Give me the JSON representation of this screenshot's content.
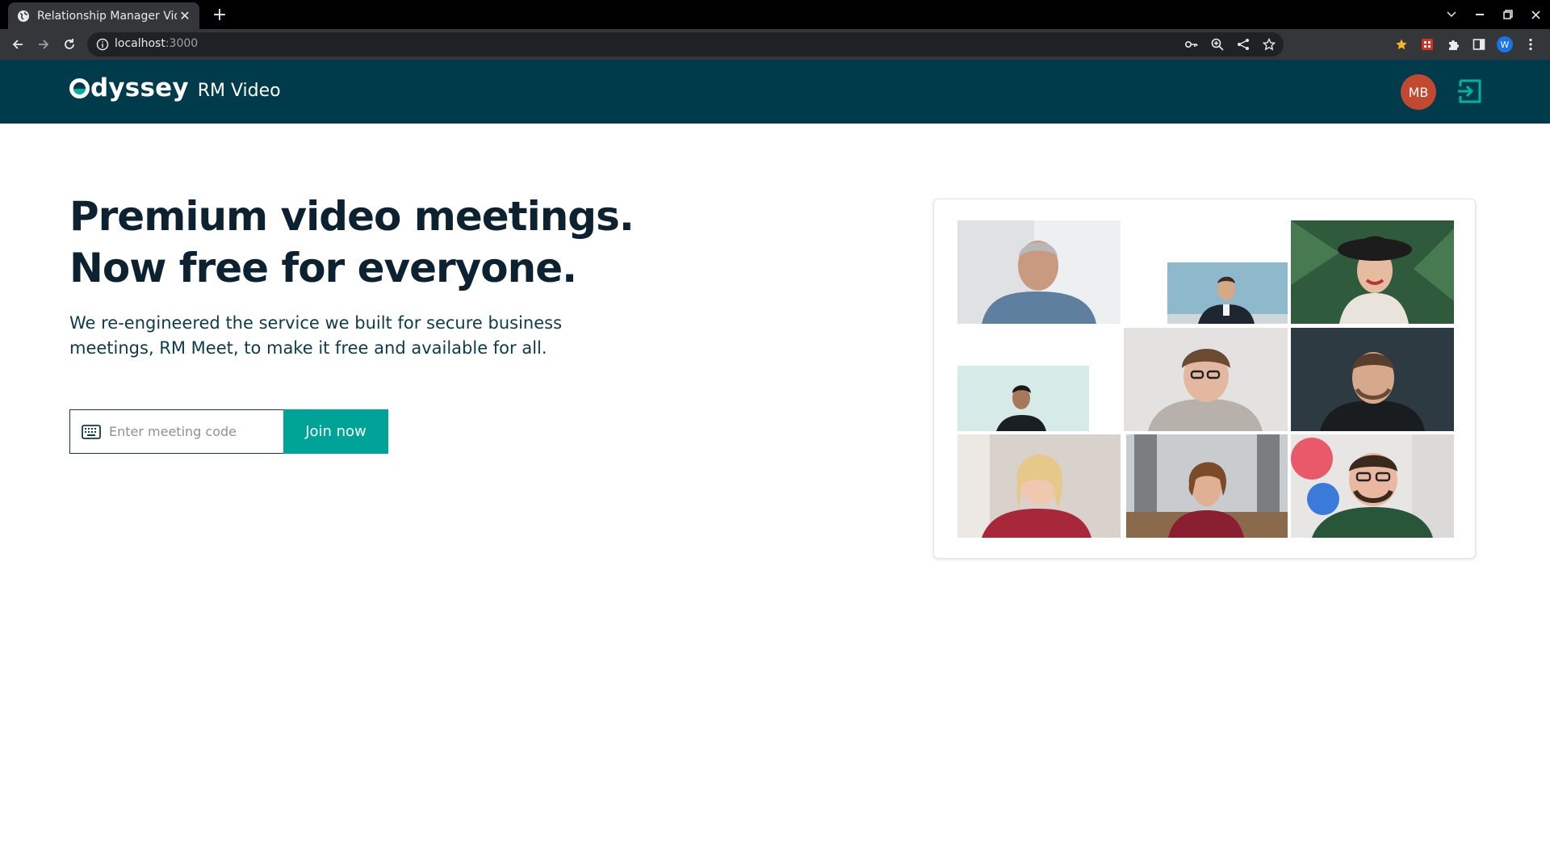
{
  "browser": {
    "tab_title": "Relationship Manager Video",
    "url_host": "localhost",
    "url_port": ":3000",
    "profile_initial": "W"
  },
  "header": {
    "brand_name": "dyssey",
    "product_name": "RM Video",
    "user_initials": "MB"
  },
  "hero": {
    "headline_line1": "Premium video meetings.",
    "headline_line2": "Now free for everyone.",
    "description": "We re-engineered the service we built for secure business meetings, RM Meet, to make it free and available for all."
  },
  "join": {
    "placeholder": "Enter meeting code",
    "button_label": "Join now"
  },
  "colors": {
    "header_bg": "#003b4b",
    "accent": "#00a398",
    "avatar": "#c2492f"
  }
}
